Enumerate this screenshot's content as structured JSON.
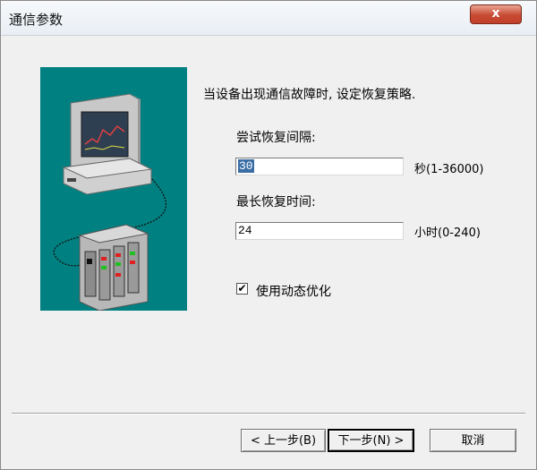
{
  "window": {
    "title": "通信参数",
    "close_label": "x"
  },
  "content": {
    "intro": "当设备出现通信故障时, 设定恢复策略.",
    "retry_interval": {
      "label": "尝试恢复间隔:",
      "value": "30",
      "unit": "秒(1-36000)"
    },
    "max_recovery": {
      "label": "最长恢复时间:",
      "value": "24",
      "unit": "小时(0-240)"
    },
    "dynamic_opt": {
      "label": "使用动态优化",
      "checked": true
    }
  },
  "buttons": {
    "back": "< 上一步(B)",
    "next": "下一步(N) >",
    "cancel": "取消"
  }
}
